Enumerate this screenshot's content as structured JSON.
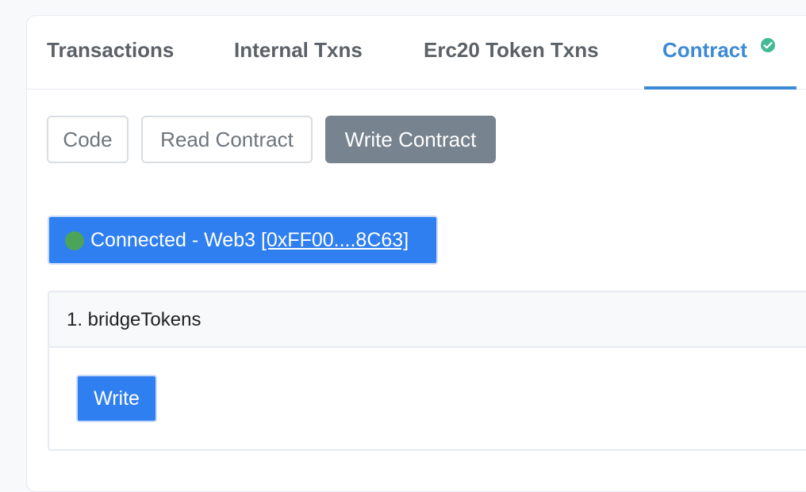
{
  "tabs": [
    {
      "label": "Transactions"
    },
    {
      "label": "Internal Txns"
    },
    {
      "label": "Erc20 Token Txns"
    },
    {
      "label": "Contract",
      "active": true,
      "verified_icon": "check-circle-icon"
    }
  ],
  "subtabs": [
    {
      "label": "Code"
    },
    {
      "label": "Read Contract"
    },
    {
      "label": "Write Contract",
      "active": true
    }
  ],
  "connection": {
    "status_label": "Connected - Web3",
    "address": "[0xFF00....8C63]",
    "status_color": "#4ca45a"
  },
  "method": {
    "title": "1. bridgeTokens",
    "write_label": "Write"
  },
  "colors": {
    "accent": "#3c8ad6",
    "primary_button": "#2f7ff1",
    "active_subtab": "#77838f"
  }
}
